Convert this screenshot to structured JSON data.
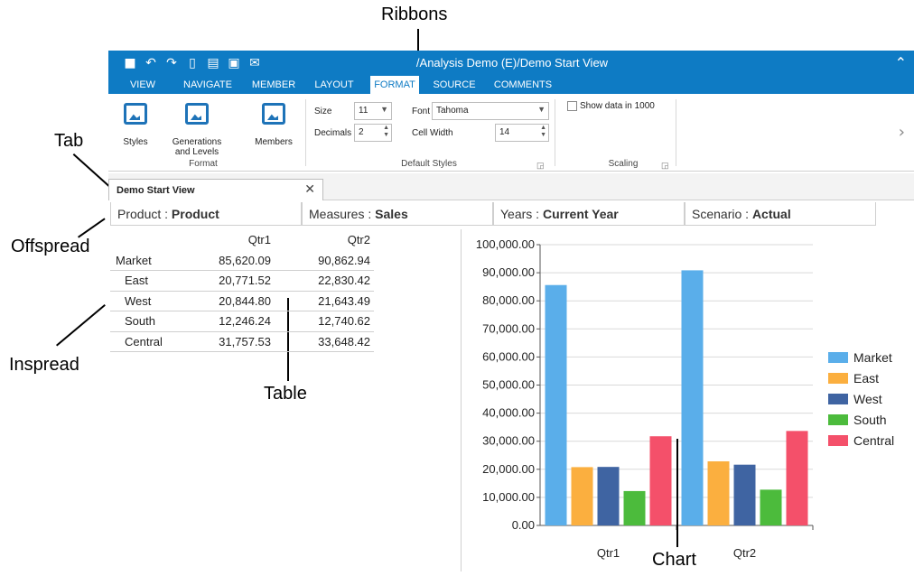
{
  "annotations": {
    "ribbons": "Ribbons",
    "tab": "Tab",
    "offspread": "Offspread",
    "inspread": "Inspread",
    "table": "Table",
    "chart": "Chart"
  },
  "window": {
    "title": "/Analysis Demo (E)/Demo Start View",
    "qat_icons": [
      "save-icon",
      "undo-icon",
      "redo-icon",
      "new-icon",
      "print-icon",
      "export-icon",
      "mail-icon"
    ]
  },
  "ribbon_tabs": [
    "VIEW",
    "NAVIGATE",
    "MEMBER",
    "LAYOUT",
    "FORMAT",
    "SOURCE",
    "COMMENTS"
  ],
  "active_tab": "FORMAT",
  "ribbon": {
    "format_group": {
      "styles_label": "Styles",
      "generations_label_1": "Generations",
      "generations_label_2": "and Levels",
      "members_label": "Members",
      "group_label": "Format"
    },
    "default_styles": {
      "size_label": "Size",
      "size_value": "11",
      "font_label": "Font",
      "font_value": "Tahoma",
      "decimals_label": "Decimals",
      "decimals_value": "2",
      "cell_width_label": "Cell Width",
      "cell_width_value": "14",
      "group_label": "Default Styles"
    },
    "scaling": {
      "show_data_label": "Show data in 1000",
      "show_data_checked": false,
      "group_label": "Scaling"
    }
  },
  "doc_tab": {
    "label": "Demo Start View"
  },
  "offspread": [
    {
      "dim": "Product",
      "member": "Product"
    },
    {
      "dim": "Measures",
      "member": "Sales"
    },
    {
      "dim": "Years",
      "member": "Current Year"
    },
    {
      "dim": "Scenario",
      "member": "Actual"
    }
  ],
  "grid": {
    "columns": [
      "Qtr1",
      "Qtr2"
    ],
    "rows": [
      {
        "label": "Market",
        "values": [
          "85,620.09",
          "90,862.94"
        ],
        "indent": false
      },
      {
        "label": "East",
        "values": [
          "20,771.52",
          "22,830.42"
        ],
        "indent": true
      },
      {
        "label": "West",
        "values": [
          "20,844.80",
          "21,643.49"
        ],
        "indent": true
      },
      {
        "label": "South",
        "values": [
          "12,246.24",
          "12,740.62"
        ],
        "indent": true
      },
      {
        "label": "Central",
        "values": [
          "31,757.53",
          "33,648.42"
        ],
        "indent": true
      }
    ]
  },
  "chart_data": {
    "type": "bar",
    "categories": [
      "Qtr1",
      "Qtr2"
    ],
    "series": [
      {
        "name": "Market",
        "values": [
          85620.09,
          90862.94
        ],
        "color": "#5aaeea"
      },
      {
        "name": "East",
        "values": [
          20771.52,
          22830.42
        ],
        "color": "#fbaf3f"
      },
      {
        "name": "West",
        "values": [
          20844.8,
          21643.49
        ],
        "color": "#3f64a2"
      },
      {
        "name": "South",
        "values": [
          12246.24,
          12740.62
        ],
        "color": "#4cbb3c"
      },
      {
        "name": "Central",
        "values": [
          31757.53,
          33648.42
        ],
        "color": "#f4506a"
      }
    ],
    "yticks": [
      "0.00",
      "10,000.00",
      "20,000.00",
      "30,000.00",
      "40,000.00",
      "50,000.00",
      "60,000.00",
      "70,000.00",
      "80,000.00",
      "90,000.00",
      "100,000.00"
    ],
    "ylim": [
      0,
      100000
    ],
    "grid": true,
    "legend": "right"
  }
}
